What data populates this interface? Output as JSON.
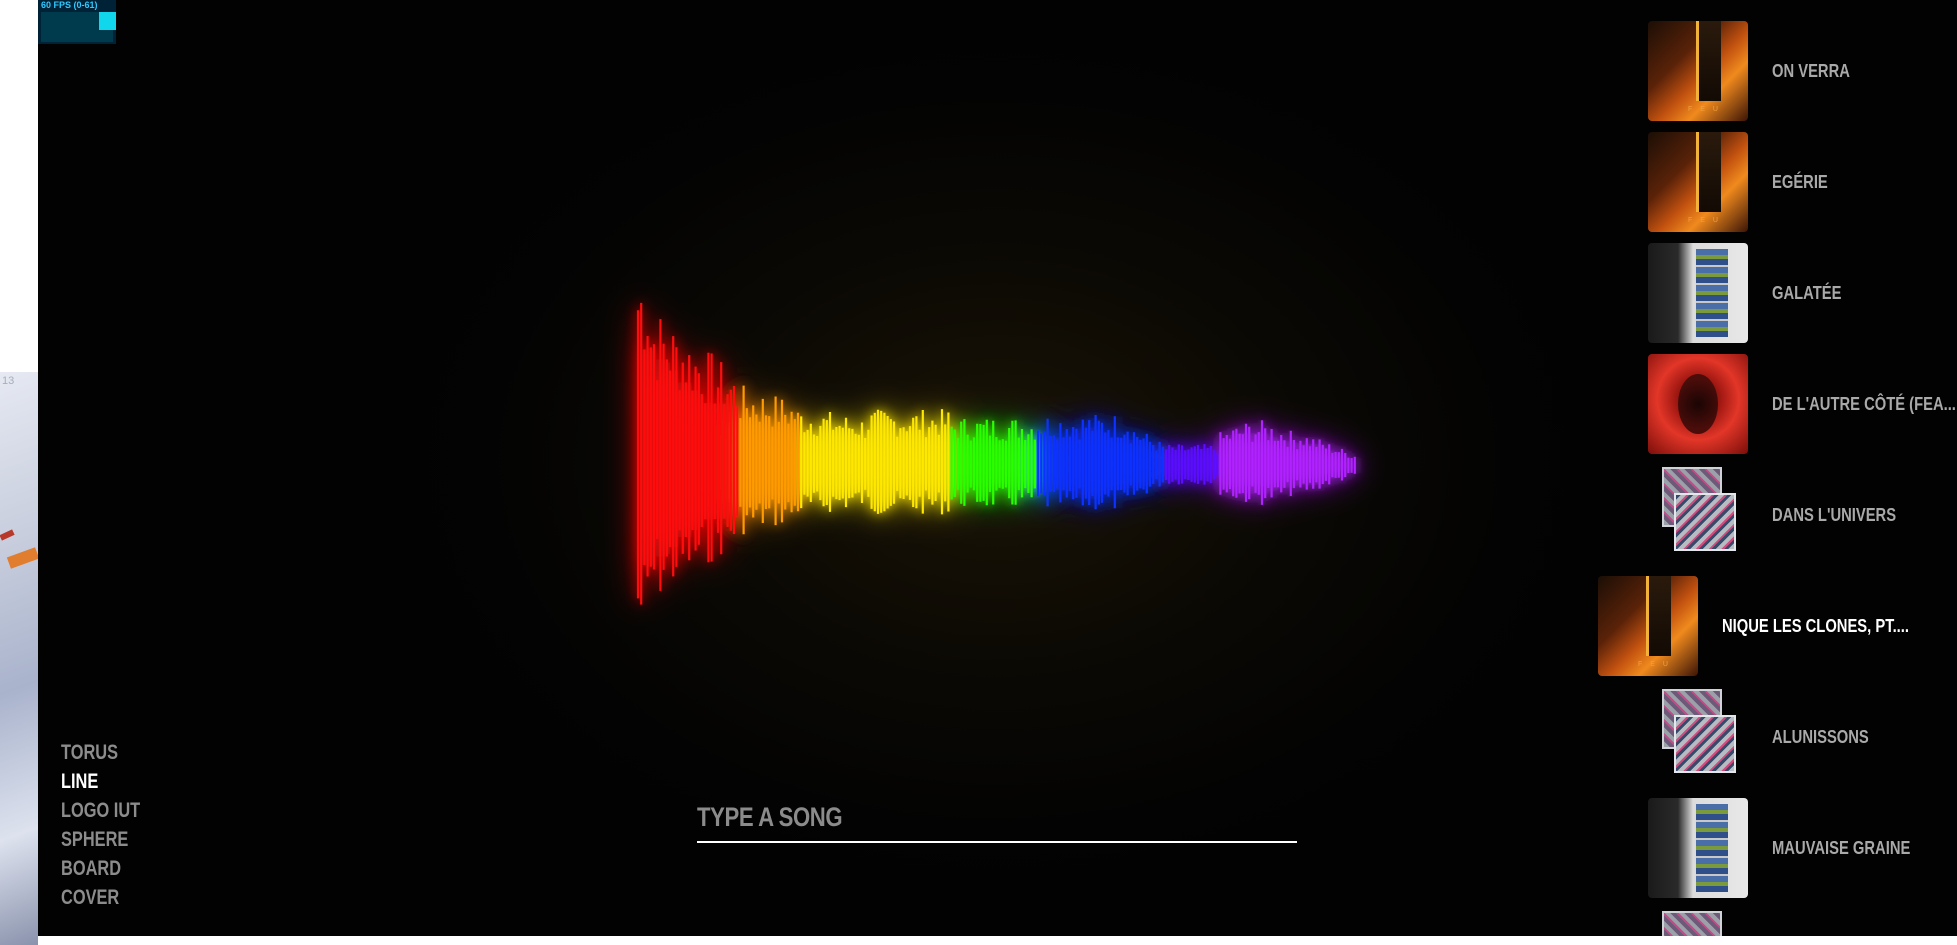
{
  "desktop": {
    "window_number": "13"
  },
  "stats": {
    "fps_label": "60 FPS (0-61)",
    "fps_level": 0.98
  },
  "visualizer": {
    "mode": "LINE",
    "spectrum_colors": [
      "#ff1010",
      "#ff9a00",
      "#ffe800",
      "#2cff00",
      "#1030ff",
      "#5a10ff",
      "#b020ff"
    ]
  },
  "search": {
    "placeholder": "TYPE A SONG",
    "value": ""
  },
  "modes": {
    "items": [
      {
        "label": "TORUS",
        "active": false
      },
      {
        "label": "LINE",
        "active": true
      },
      {
        "label": "LOGO IUT",
        "active": false
      },
      {
        "label": "SPHERE",
        "active": false
      },
      {
        "label": "BOARD",
        "active": false
      },
      {
        "label": "COVER",
        "active": false
      }
    ]
  },
  "playlist": {
    "tracks": [
      {
        "title": "ON VERRA",
        "cover": "art-feu",
        "active": false
      },
      {
        "title": "EGÉRIE",
        "cover": "art-feu",
        "active": false
      },
      {
        "title": "GALATÉE",
        "cover": "art-galatee",
        "active": false
      },
      {
        "title": "DE L'AUTRE CÔTÉ (FEA...",
        "cover": "art-red",
        "active": false
      },
      {
        "title": "DANS L'UNIVERS",
        "cover": "art-univers",
        "active": false
      },
      {
        "title": "NIQUE LES CLONES, PT....",
        "cover": "art-feu",
        "active": true
      },
      {
        "title": "ALUNISSONS",
        "cover": "art-univers",
        "active": false
      },
      {
        "title": "MAUVAISE GRAINE",
        "cover": "art-galatee",
        "active": false
      }
    ]
  }
}
